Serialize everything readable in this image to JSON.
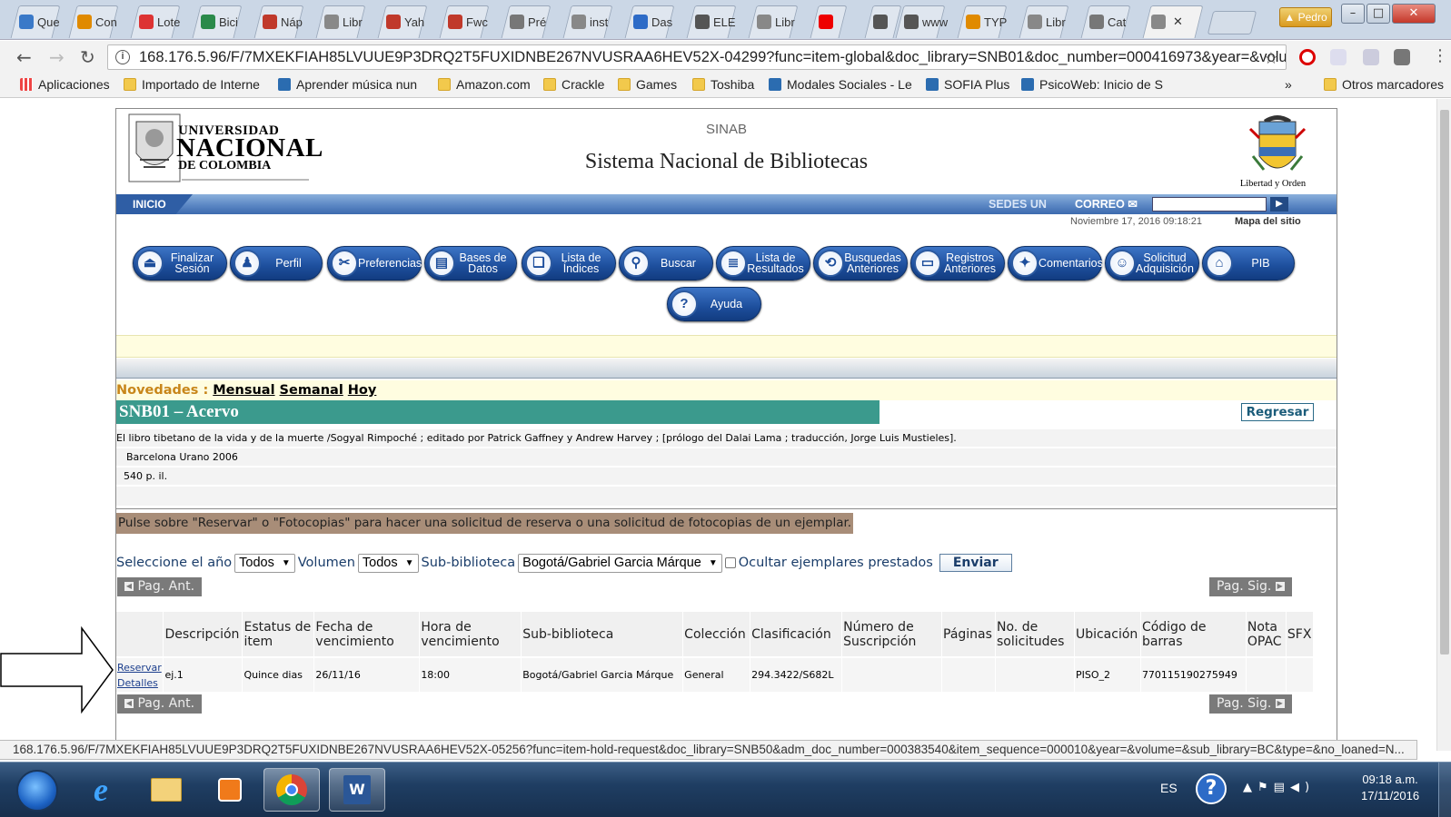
{
  "browser": {
    "tabs": [
      {
        "label": "Que",
        "icon": "app-icon",
        "color": "#3a79c8"
      },
      {
        "label": "Con",
        "icon": "app-icon",
        "color": "#e08a00"
      },
      {
        "label": "Lote",
        "icon": "app-icon",
        "color": "#d33"
      },
      {
        "label": "Bici",
        "icon": "app-icon",
        "color": "#2a8a4a"
      },
      {
        "label": "Náp",
        "icon": "app-icon",
        "color": "#c0392b"
      },
      {
        "label": "Libr",
        "icon": "doc-icon",
        "color": "#888"
      },
      {
        "label": "Yah",
        "icon": "gmail-icon",
        "color": "#c0392b"
      },
      {
        "label": "Fwc",
        "icon": "gmail-icon",
        "color": "#c0392b"
      },
      {
        "label": "Pré",
        "icon": "app-icon",
        "color": "#777"
      },
      {
        "label": "inst",
        "icon": "doc-icon",
        "color": "#888"
      },
      {
        "label": "Das",
        "icon": "help-icon",
        "color": "#2d6bc7"
      },
      {
        "label": "ELE",
        "icon": "app-icon",
        "color": "#555"
      },
      {
        "label": "Libr",
        "icon": "doc-icon",
        "color": "#888"
      },
      {
        "label": "",
        "icon": "youtube-icon",
        "color": "#e00"
      },
      {
        "label": "",
        "icon": "speaker-icon",
        "color": "#555"
      },
      {
        "label": "www",
        "icon": "app-icon",
        "color": "#555"
      },
      {
        "label": "TYP",
        "icon": "app-icon",
        "color": "#e08a00"
      },
      {
        "label": "Libr",
        "icon": "doc-icon",
        "color": "#888"
      },
      {
        "label": "Cat",
        "icon": "app-icon",
        "color": "#777"
      },
      {
        "label": "",
        "icon": "doc-icon",
        "color": "#888",
        "active": true
      }
    ],
    "profile_name": "Pedro",
    "url": "168.176.5.96/F/7MXEKFIAH85LVUUE9P3DRQ2T5FUXIDNBE267NVUSRAA6HEV52X-04299?func=item-global&doc_library=SNB01&doc_number=000416973&year=&volum",
    "bookmarks": [
      {
        "label": "Aplicaciones",
        "icon": "apps-grid-icon"
      },
      {
        "label": "Importado de Interne",
        "icon": "folder-icon"
      },
      {
        "label": "Aprender música nun",
        "icon": "app-icon"
      },
      {
        "label": "Amazon.com",
        "icon": "folder-icon"
      },
      {
        "label": "Crackle",
        "icon": "folder-icon"
      },
      {
        "label": "Games",
        "icon": "folder-icon"
      },
      {
        "label": "Toshiba",
        "icon": "folder-icon"
      },
      {
        "label": "Modales Sociales - Le",
        "icon": "chat-icon"
      },
      {
        "label": "SOFIA Plus",
        "icon": "app-icon"
      },
      {
        "label": "PsicoWeb: Inicio de S",
        "icon": "app-icon"
      }
    ],
    "bookmarks_more": "»",
    "other_bookmarks": "Otros marcadores",
    "status_url": "168.176.5.96/F/7MXEKFIAH85LVUUE9P3DRQ2T5FUXIDNBE267NVUSRAA6HEV52X-05256?func=item-hold-request&doc_library=SNB50&adm_doc_number=000383540&item_sequence=000010&year=&volume=&sub_library=BC&type=&no_loaned=N..."
  },
  "header": {
    "logo_line1": "UNIVERSIDAD",
    "logo_line2": "NACIONAL",
    "logo_line3": "DE COLOMBIA",
    "sinab": "SINAB",
    "title": "Sistema Nacional de Bibliotecas",
    "escudo_caption": "Libertad y Orden",
    "inicio": "INICIO",
    "sedes": "SEDES UN",
    "correo": "CORREO",
    "datetime": "Noviembre 17, 2016 09:18:21",
    "sitemap": "Mapa del sitio"
  },
  "menu": [
    {
      "label": "Finalizar Sesión",
      "icon": "logout-icon"
    },
    {
      "label": "Perfil",
      "icon": "user-icon"
    },
    {
      "label": "Preferencias",
      "icon": "tools-icon"
    },
    {
      "label": "Bases de Datos",
      "icon": "database-icon"
    },
    {
      "label": "Lista de Índices",
      "icon": "book-icon"
    },
    {
      "label": "Buscar",
      "icon": "search-icon"
    },
    {
      "label": "Lista de Resultados",
      "icon": "list-icon"
    },
    {
      "label": "Busquedas Anteriores",
      "icon": "history-search-icon"
    },
    {
      "label": "Registros Anteriores",
      "icon": "folder-icon"
    },
    {
      "label": "Comentarios",
      "icon": "bulb-icon"
    },
    {
      "label": "Solicitud Adquisición",
      "icon": "users-icon"
    },
    {
      "label": "PIB",
      "icon": "building-icon"
    },
    {
      "label": "Ayuda",
      "icon": "help-icon"
    }
  ],
  "novedades": {
    "label": "Novedades :",
    "links": [
      "Mensual",
      "Semanal",
      "Hoy"
    ]
  },
  "record": {
    "section_title": "SNB01 – Acervo",
    "back_button": "Regresar",
    "lines": [
      "El libro tibetano de la vida y de la muerte /Sogyal Rimpoché ; editado por Patrick Gaffney y Andrew Harvey ; [prólogo del Dalai Lama ; traducción, Jorge Luis Mustieles].",
      "Barcelona Urano 2006",
      "540 p.  il.",
      ""
    ]
  },
  "notice": "Pulse sobre \"Reservar\" o \"Fotocopias\" para hacer una solicitud de reserva o una solicitud de fotocopias de un ejemplar.",
  "filters": {
    "year_label": "Seleccione el año",
    "year_value": "Todos",
    "volume_label": "Volumen",
    "volume_value": "Todos",
    "sublib_label": "Sub-biblioteca",
    "sublib_value": "Bogotá/Gabriel Garcia Márque",
    "hide_loaned_label": "Ocultar ejemplares prestados",
    "submit": "Enviar"
  },
  "pagination": {
    "prev": "Pag. Ant.",
    "next": "Pag. Sig."
  },
  "table": {
    "headers": [
      "",
      "Descripción",
      "Estatus de item",
      "Fecha de vencimiento",
      "Hora de vencimiento",
      "Sub-biblioteca",
      "Colección",
      "Clasificación",
      "Número de Suscripción",
      "Páginas",
      "No. de solicitudes",
      "Ubicación",
      "Código de barras",
      "Nota OPAC",
      "SFX"
    ],
    "rows": [
      {
        "actions": [
          "Reservar",
          "Detalles"
        ],
        "cells": [
          "ej.1",
          "Quince dias",
          "26/11/16",
          "18:00",
          "Bogotá/Gabriel Garcia Márque",
          "General",
          "294.3422/S682L",
          "",
          "",
          "",
          "PISO_2",
          "770115190275949",
          "",
          ""
        ]
      }
    ]
  },
  "taskbar": {
    "apps": [
      "start-orb",
      "internet-explorer-icon",
      "file-explorer-icon",
      "media-player-icon",
      "chrome-icon",
      "word-icon"
    ],
    "language": "ES",
    "time": "09:18 a.m.",
    "date": "17/11/2016"
  }
}
